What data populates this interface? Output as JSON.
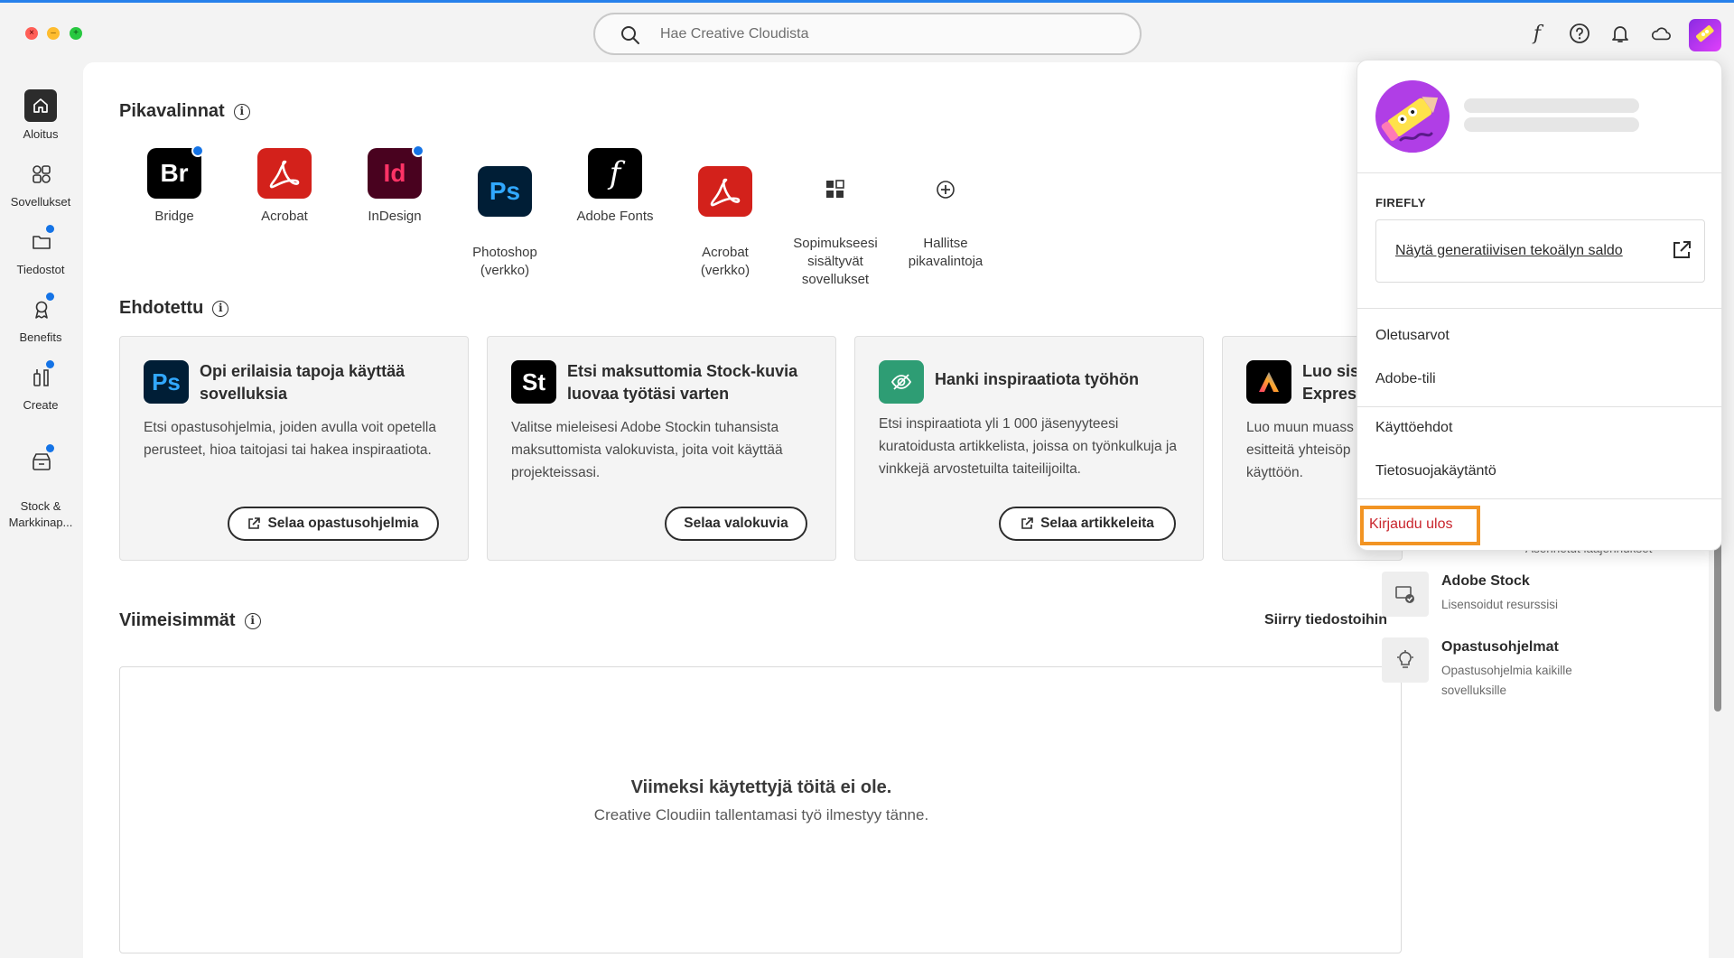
{
  "topbar": {
    "search_placeholder": "Hae Creative Cloudista"
  },
  "sidebar": {
    "items": [
      {
        "label": "Aloitus",
        "icon": "home-icon",
        "active": true
      },
      {
        "label": "Sovellukset",
        "icon": "apps-icon"
      },
      {
        "label": "Tiedostot",
        "icon": "folder-icon",
        "badge": true
      },
      {
        "label": "Benefits",
        "icon": "award-icon",
        "badge": true
      },
      {
        "label": "Create",
        "icon": "create-tools-icon",
        "badge": true
      },
      {
        "label": "Stock &\nMarkkinap...",
        "icon": "stock-icon",
        "badge": true
      }
    ]
  },
  "quick": {
    "title": "Pikavalinnat",
    "apps": [
      {
        "label": "Bridge",
        "abbr": "Br",
        "color": "#000000",
        "text": "#ffffff",
        "badge": true
      },
      {
        "label": "Acrobat",
        "icon": "acrobat-icon",
        "color": "#d3211b"
      },
      {
        "label": "InDesign",
        "abbr": "Id",
        "color": "#49021f",
        "text": "#ff3366",
        "badge": true
      },
      {
        "label": "Photoshop\n(verkko)",
        "abbr": "Ps",
        "color": "#001e36",
        "text": "#31a8ff"
      },
      {
        "label": "Adobe Fonts",
        "abbr": "f",
        "color": "#000000",
        "text": "#ffffff"
      },
      {
        "label": "Acrobat\n(verkko)",
        "icon": "acrobat-icon",
        "color": "#d3211b"
      },
      {
        "label": "Sopimukseesi\nsisältyvät\nsovellukset",
        "icon": "grid-icon"
      },
      {
        "label": "Hallitse\npikavalintoja",
        "icon": "add-circle-icon"
      }
    ]
  },
  "suggested": {
    "title": "Ehdotettu",
    "cards": [
      {
        "abbr": "Ps",
        "color": "#001e36",
        "text": "#31a8ff",
        "title": "Opi erilaisia tapoja käyttää sovelluksia",
        "body": "Etsi opastusohjelmia, joiden avulla voit opetella perusteet, hioa taitojasi tai hakea inspiraatiota.",
        "button": "Selaa opastusohjelmia"
      },
      {
        "abbr": "St",
        "color": "#000000",
        "text": "#ffffff",
        "title": "Etsi maksuttomia Stock-kuvia luovaa työtäsi varten",
        "body": "Valitse mieleisesi Adobe Stockin tuhansista maksuttomista valokuvista, joita voit käyttää projekteissasi.",
        "button": "Selaa valokuvia"
      },
      {
        "icon": "inspiration-icon",
        "color": "#2e9d74",
        "title": "Hanki inspiraatiota työhön",
        "body": "Etsi inspiraatiota yli 1 000 jäsenyyteesi kuratoidusta artikkelista, joissa on työnkulkuja ja vinkkejä arvostetuilta taiteilijoilta.",
        "button": "Selaa artikkeleita"
      },
      {
        "icon": "express-icon",
        "color": "#000000",
        "title": "Luo sisä\nExpress",
        "body": "Luo muun muass\nesitteitä yhteisöp\nkäyttöön."
      }
    ]
  },
  "recent": {
    "title": "Viimeisimmät",
    "goto_files": "Siirry tiedostoihin",
    "empty_title": "Viimeksi käytettyjä töitä ei ole.",
    "empty_sub": "Creative Cloudiin tallentamasi työ ilmestyy tänne."
  },
  "resources": {
    "partial_desc": "Asennetut laajennukset",
    "items": [
      {
        "title": "Adobe Stock",
        "desc": "Lisensoidut resurssisi",
        "icon": "stock-license-icon"
      },
      {
        "title": "Opastusohjelmat",
        "desc": "Opastusohjelmia kaikille sovelluksille",
        "icon": "lightbulb-icon"
      }
    ]
  },
  "account_menu": {
    "firefly_caption": "FIREFLY",
    "credits_link": "Näytä generatiivisen tekoälyn saldo",
    "items": [
      "Oletusarvot",
      "Adobe-tili",
      "Käyttöehdot",
      "Tietosuojakäytäntö"
    ],
    "sign_out": "Kirjaudu ulos",
    "highlight_color": "#f29423"
  }
}
